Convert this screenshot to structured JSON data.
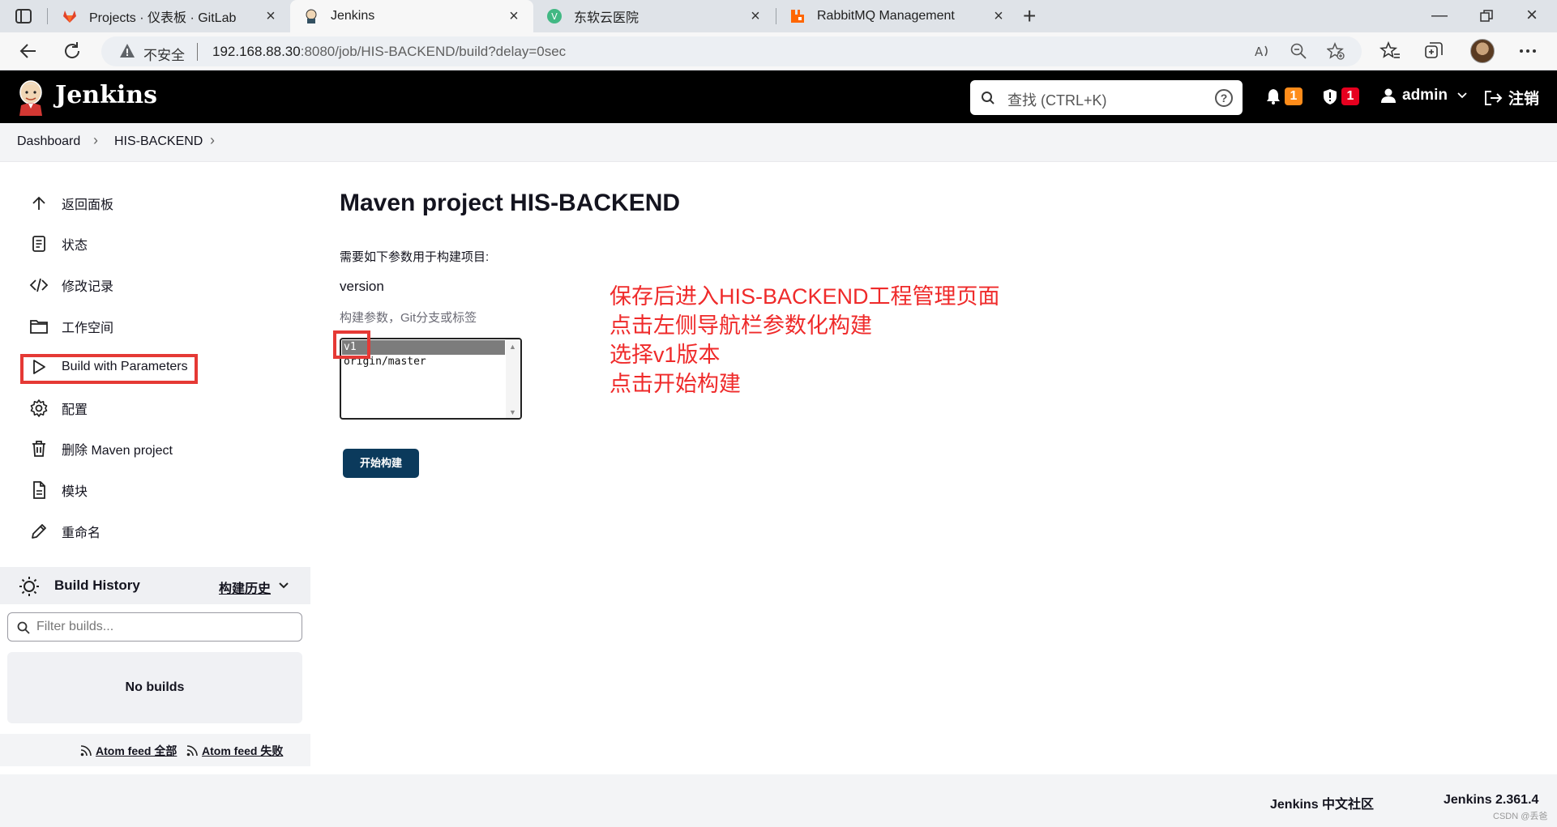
{
  "browser": {
    "tabs": [
      {
        "title": "Projects · 仪表板 · GitLab",
        "icon": "gitlab-icon"
      },
      {
        "title": "Jenkins",
        "icon": "jenkins-icon"
      },
      {
        "title": "东软云医院",
        "icon": "vue-icon"
      },
      {
        "title": "RabbitMQ Management",
        "icon": "rabbitmq-icon"
      }
    ],
    "security_label": "不安全",
    "url_host": "192.168.88.30",
    "url_rest": ":8080/job/HIS-BACKEND/build?delay=0sec"
  },
  "header": {
    "brand": "Jenkins",
    "search_placeholder": "查找 (CTRL+K)",
    "help_glyph": "?",
    "notifications_count": "1",
    "security_count": "1",
    "user": "admin",
    "logout": "注销"
  },
  "breadcrumb": [
    "Dashboard",
    "HIS-BACKEND"
  ],
  "sidebar": {
    "items": [
      {
        "label": "返回面板",
        "icon": "arrow-up-icon"
      },
      {
        "label": "状态",
        "icon": "document-icon"
      },
      {
        "label": "修改记录",
        "icon": "code-icon"
      },
      {
        "label": "工作空间",
        "icon": "folder-icon"
      },
      {
        "label": "Build with Parameters",
        "icon": "play-icon"
      },
      {
        "label": "配置",
        "icon": "gear-icon"
      },
      {
        "label": "删除 Maven project",
        "icon": "trash-icon"
      },
      {
        "label": "模块",
        "icon": "file-icon"
      },
      {
        "label": "重命名",
        "icon": "pencil-icon"
      }
    ]
  },
  "build_history": {
    "title": "Build History",
    "trend_link": "构建历史",
    "filter_placeholder": "Filter builds...",
    "empty": "No builds",
    "feeds": [
      "Atom feed 全部",
      "Atom feed 失败"
    ]
  },
  "main": {
    "title": "Maven project HIS-BACKEND",
    "intro": "需要如下参数用于构建项目:",
    "param_name": "version",
    "param_desc": "构建参数，Git分支或标签",
    "options": [
      "v1",
      "origin/master"
    ],
    "selected_option": "v1",
    "build_button": "开始构建"
  },
  "annotation": {
    "lines": [
      "保存后进入HIS-BACKEND工程管理页面",
      "点击左侧导航栏参数化构建",
      "选择v1版本",
      "点击开始构建"
    ],
    "color": "#ef2a2a"
  },
  "footer": {
    "community": "Jenkins 中文社区",
    "version": "Jenkins 2.361.4",
    "watermark": "CSDN @丢爸"
  },
  "colors": {
    "header_bg": "#000000",
    "build_button": "#0b3a5c",
    "highlight_box": "#e53935",
    "badge_orange": "#fe8c1a",
    "badge_red": "#e6001f"
  }
}
